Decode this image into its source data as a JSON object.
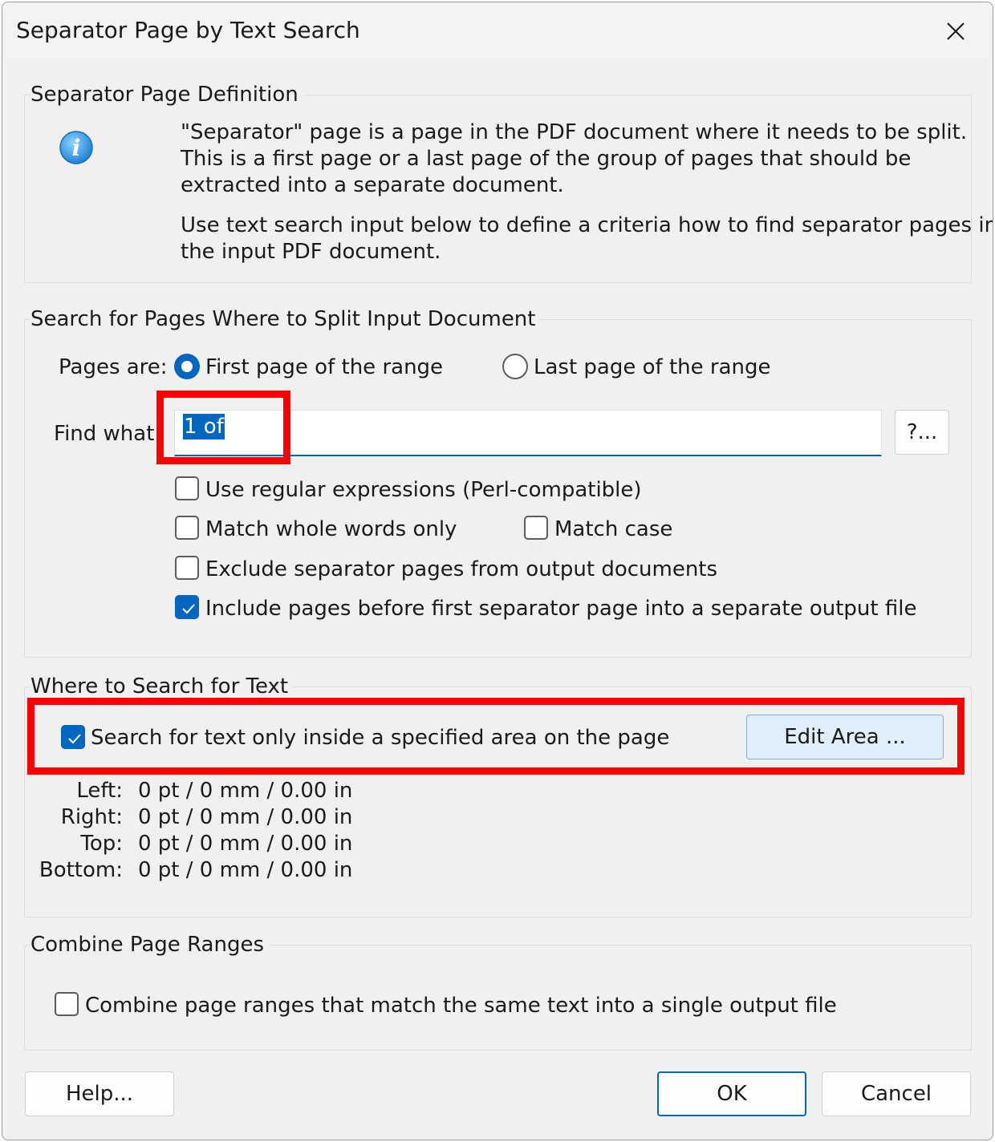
{
  "dialog": {
    "title": "Separator Page by Text Search"
  },
  "definition": {
    "legend": "Separator Page Definition",
    "line1": "\"Separator\" page is a page in the PDF document where it needs to be split.",
    "line2": "This is a first page or a last page of the group of pages that should be",
    "line3": "extracted into a separate document.",
    "line4": "Use text search input below to define a criteria how to find separator pages in",
    "line5": "the input PDF document."
  },
  "search": {
    "legend": "Search for Pages Where to Split Input Document",
    "pages_are_label": "Pages are:",
    "radio_first_label": "First page of the range",
    "radio_last_label": "Last page of the range",
    "radio_first_selected": true,
    "find_what_label": "Find what:",
    "find_what_value": "1 of",
    "options_button_label": "?...",
    "regex_label": "Use regular expressions (Perl-compatible)",
    "regex_checked": false,
    "whole_words_label": "Match whole words only",
    "whole_words_checked": false,
    "match_case_label": "Match case",
    "match_case_checked": false,
    "exclude_label": "Exclude separator pages from output documents",
    "exclude_checked": false,
    "include_before_label": "Include pages before first separator page into a separate output file",
    "include_before_checked": true
  },
  "where": {
    "legend": "Where to Search for Text",
    "area_only_label": "Search for text only inside a specified area on the page",
    "area_only_checked": true,
    "edit_area_label": "Edit Area ...",
    "margins": [
      {
        "label": "Left:",
        "value": "0 pt / 0 mm / 0.00 in"
      },
      {
        "label": "Right:",
        "value": "0 pt / 0 mm / 0.00 in"
      },
      {
        "label": "Top:",
        "value": "0 pt / 0 mm / 0.00 in"
      },
      {
        "label": "Bottom:",
        "value": "0 pt / 0 mm / 0.00 in"
      }
    ]
  },
  "combine": {
    "legend": "Combine Page Ranges",
    "combine_label": "Combine page ranges that match the same text into a single output file",
    "combine_checked": false
  },
  "footer": {
    "help_label": "Help...",
    "ok_label": "OK",
    "cancel_label": "Cancel"
  },
  "colors": {
    "accent": "#0067c0",
    "highlight_box": "#ff0000",
    "dialog_bg": "#f0f0f0"
  },
  "icons": {
    "info": "info-icon",
    "close": "close-icon",
    "check": "check-icon"
  }
}
